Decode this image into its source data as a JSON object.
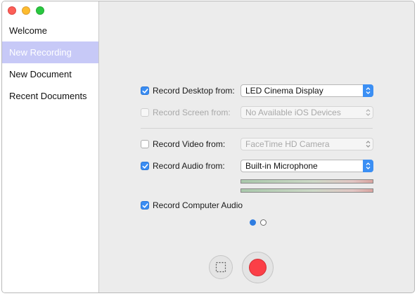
{
  "window": {
    "controls": [
      {
        "name": "close-window-button",
        "color": "#fc5f57"
      },
      {
        "name": "minimize-window-button",
        "color": "#fdbc2e"
      },
      {
        "name": "zoom-window-button",
        "color": "#28c840"
      }
    ]
  },
  "sidebar": {
    "items": [
      {
        "label": "Welcome",
        "selected": false
      },
      {
        "label": "New Recording",
        "selected": true
      },
      {
        "label": "New Document",
        "selected": false
      },
      {
        "label": "Recent Documents",
        "selected": false
      }
    ]
  },
  "settings": {
    "record_desktop": {
      "label": "Record Desktop from:",
      "checked": true,
      "enabled": true,
      "value": "LED Cinema Display"
    },
    "record_screen": {
      "label": "Record Screen from:",
      "checked": false,
      "enabled": false,
      "value": "No Available iOS Devices"
    },
    "record_video": {
      "label": "Record Video from:",
      "checked": false,
      "enabled": true,
      "value": "FaceTime HD Camera"
    },
    "record_audio": {
      "label": "Record Audio from:",
      "checked": true,
      "enabled": true,
      "value": "Built-in Microphone"
    },
    "record_computer_audio": {
      "label": "Record Computer Audio",
      "checked": true,
      "enabled": true
    }
  },
  "pager": {
    "pages": 2,
    "current": 1
  },
  "colors": {
    "accent": "#3a8df3",
    "record": "#fb3f47",
    "selection": "#c7c9f7"
  }
}
